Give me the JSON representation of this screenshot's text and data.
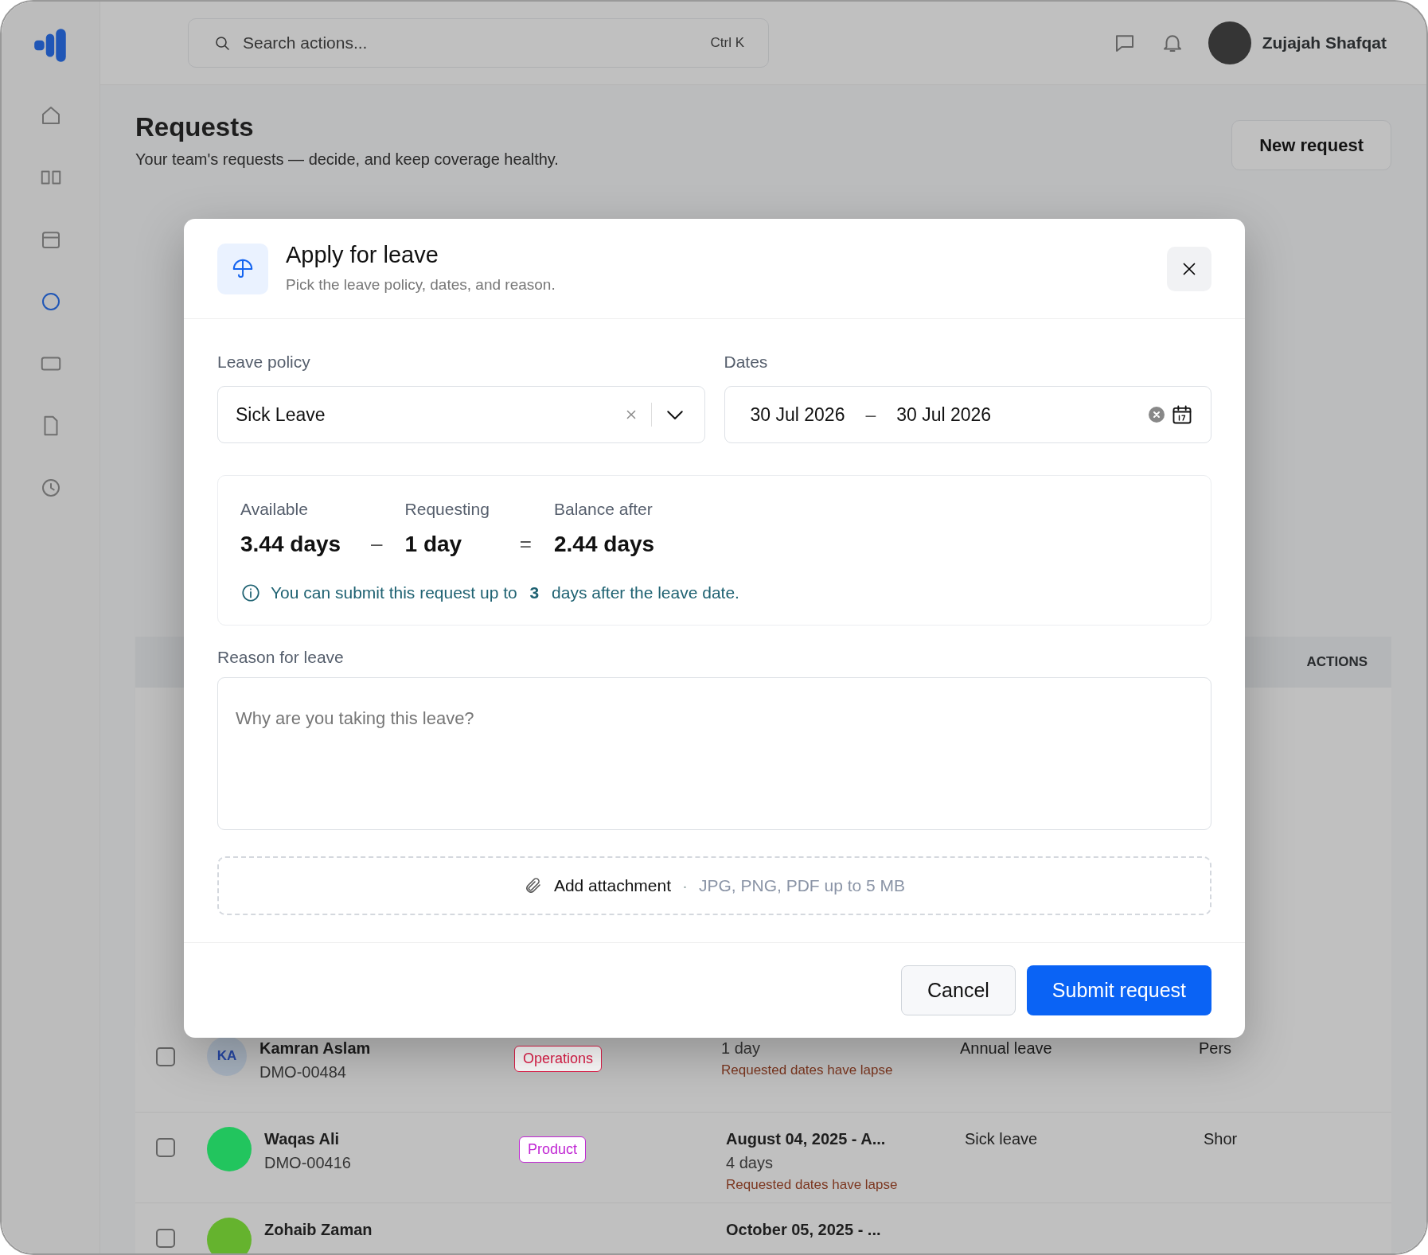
{
  "app": {
    "search_placeholder": "Search actions...",
    "search_shortcut": "Ctrl K",
    "user_name": "Zujajah Shafqat"
  },
  "page": {
    "title": "Requests",
    "subtitle": "Your team's requests — decide, and keep coverage healthy.",
    "new_request": "New request"
  },
  "table": {
    "actions_heading": "ACTIONS",
    "rows": [
      {
        "checked": false,
        "avatar": {
          "kind": "initials",
          "text": "KA"
        },
        "name": "Kamran Aslam",
        "id": "DMO-00484",
        "department": "Operations",
        "color": "#e11d48",
        "duration": "1 day",
        "warning": "Requested dates have lapse",
        "type": "Annual leave",
        "reason": "Pers"
      },
      {
        "checked": false,
        "avatar": {
          "kind": "dot",
          "color": "#22c55e"
        },
        "name": "Waqas Ali",
        "id": "DMO-00416",
        "department": "Product",
        "color": "#c026d3",
        "dates": "August 04, 2025 - A...",
        "duration": "4 days",
        "warning": "Requested dates have lapse",
        "type": "Sick leave",
        "reason": "Shor"
      },
      {
        "checked": false,
        "avatar": {
          "kind": "dot",
          "color": "#65b32e"
        },
        "name": "Zohaib Zaman",
        "dates": "October 05, 2025 - ..."
      }
    ]
  },
  "dialog": {
    "title": "Apply for leave",
    "subtitle": "Pick the leave policy, dates, and reason.",
    "policy": {
      "label": "Leave policy",
      "value": "Sick Leave"
    },
    "dates": {
      "label": "Dates",
      "start": "30 Jul 2026",
      "separator": "–",
      "end": "30 Jul 2026"
    },
    "balance": [
      {
        "kind": "figure",
        "label": "Available",
        "value": "3.44 days"
      },
      {
        "kind": "operator",
        "symbol": "–"
      },
      {
        "kind": "figure",
        "label": "Requesting",
        "value": "1 day"
      },
      {
        "kind": "operator",
        "symbol": "="
      },
      {
        "kind": "figure",
        "label": "Balance after",
        "value": "2.44 days"
      }
    ],
    "note": "You can submit this request up to **3** days after the leave date.",
    "reason": {
      "label": "Reason for leave",
      "placeholder": "Why are you taking this leave?"
    },
    "attachment": {
      "label": "Add attachment",
      "separator": "·",
      "hint": "JPG, PNG, PDF up to 5 MB"
    },
    "buttons": [
      {
        "label": "Cancel",
        "kind": "secondary"
      },
      {
        "label": "Submit request",
        "kind": "primary"
      }
    ]
  }
}
